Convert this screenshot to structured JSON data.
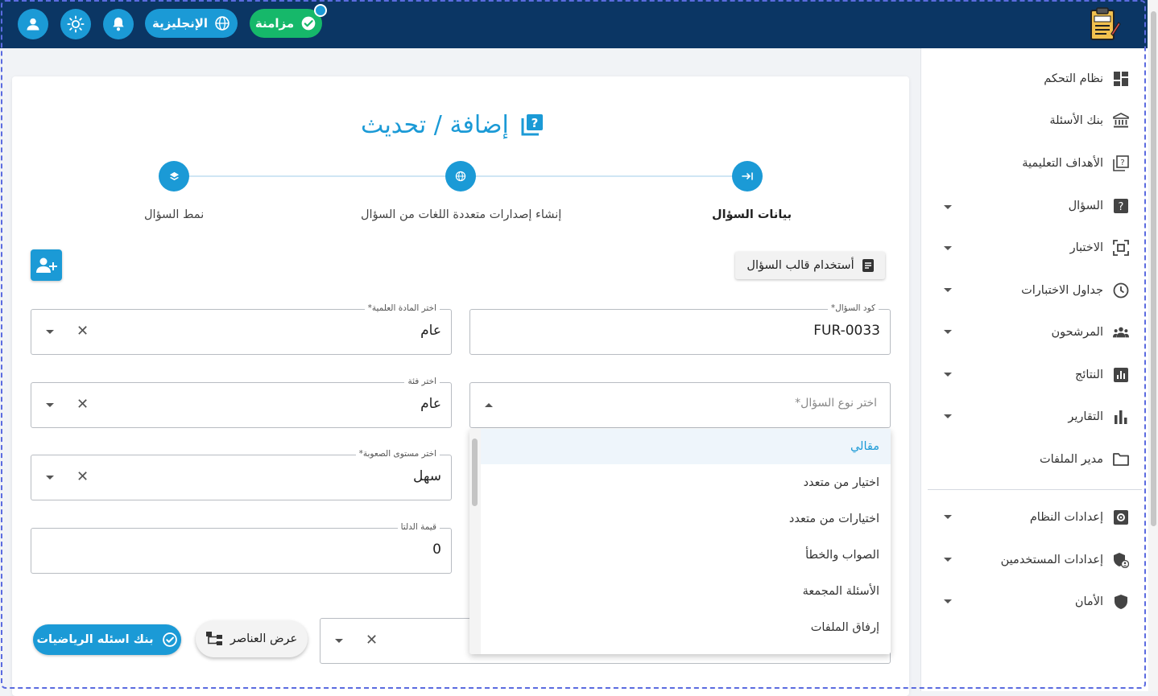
{
  "topbar": {
    "sync_label": "مزامنة",
    "language_label": "الإنجليزية",
    "logo_icon": "exam-clipboard-icon",
    "icons": [
      "user-icon",
      "sun-icon",
      "bell-icon",
      "globe-icon",
      "check-circle-icon"
    ]
  },
  "sidebar": {
    "items": [
      {
        "label": "نظام التحكم",
        "icon": "dashboard-icon",
        "expandable": false
      },
      {
        "label": "بنك الأسئلة",
        "icon": "bank-icon",
        "expandable": false
      },
      {
        "label": "الأهداف التعليمية",
        "icon": "objectives-icon",
        "expandable": false
      },
      {
        "label": "السؤال",
        "icon": "question-icon",
        "expandable": true
      },
      {
        "label": "الاختبار",
        "icon": "exam-icon",
        "expandable": true
      },
      {
        "label": "جداول الاختبارات",
        "icon": "clock-icon",
        "expandable": true
      },
      {
        "label": "المرشحون",
        "icon": "people-icon",
        "expandable": true
      },
      {
        "label": "النتائج",
        "icon": "results-icon",
        "expandable": true
      },
      {
        "label": "التقارير",
        "icon": "bar-chart-icon",
        "expandable": true
      },
      {
        "label": "مدير الملفات",
        "icon": "folder-icon",
        "expandable": false
      },
      {
        "label": "إعدادات النظام",
        "icon": "settings-icon",
        "expandable": true
      },
      {
        "label": "إعدادات المستخدمين",
        "icon": "user-shield-icon",
        "expandable": true
      },
      {
        "label": "الأمان",
        "icon": "shield-icon",
        "expandable": true
      }
    ]
  },
  "main": {
    "title": "إضافة / تحديث",
    "steps": [
      {
        "label": "بيانات السؤال",
        "active": true
      },
      {
        "label": "إنشاء إصدارات متعددة اللغات من السؤال",
        "active": false
      },
      {
        "label": "نمط السؤال",
        "active": false
      }
    ],
    "template_button": "أستخدام قالب السؤال",
    "fields": {
      "code": {
        "label": "كود السؤال*",
        "value": "FUR-0033"
      },
      "subject": {
        "label": "اختر المادة العلمية*",
        "value": "عام"
      },
      "type": {
        "placeholder": "اختر نوع السؤال*"
      },
      "category": {
        "label": "اختر فئة",
        "value": "عام"
      },
      "difficulty": {
        "label": "اختر مستوى الصعوبة*",
        "value": "سهل"
      },
      "delta": {
        "label": "قيمة الدلتا",
        "value": "0"
      }
    },
    "type_options": [
      "مقالي",
      "اختيار من متعدد",
      "اختيارات من متعدد",
      "الصواب والخطأ",
      "الأسئلة المجمعة",
      "إرفاق الملفات"
    ],
    "type_selected_index": 0,
    "math_bank_button": "بنك اسئله الرياضيات",
    "elements_button": "عرض العناصر"
  },
  "colors": {
    "topbar": "#0b3664",
    "accent": "#1b9ad6",
    "sync": "#16b86a"
  }
}
